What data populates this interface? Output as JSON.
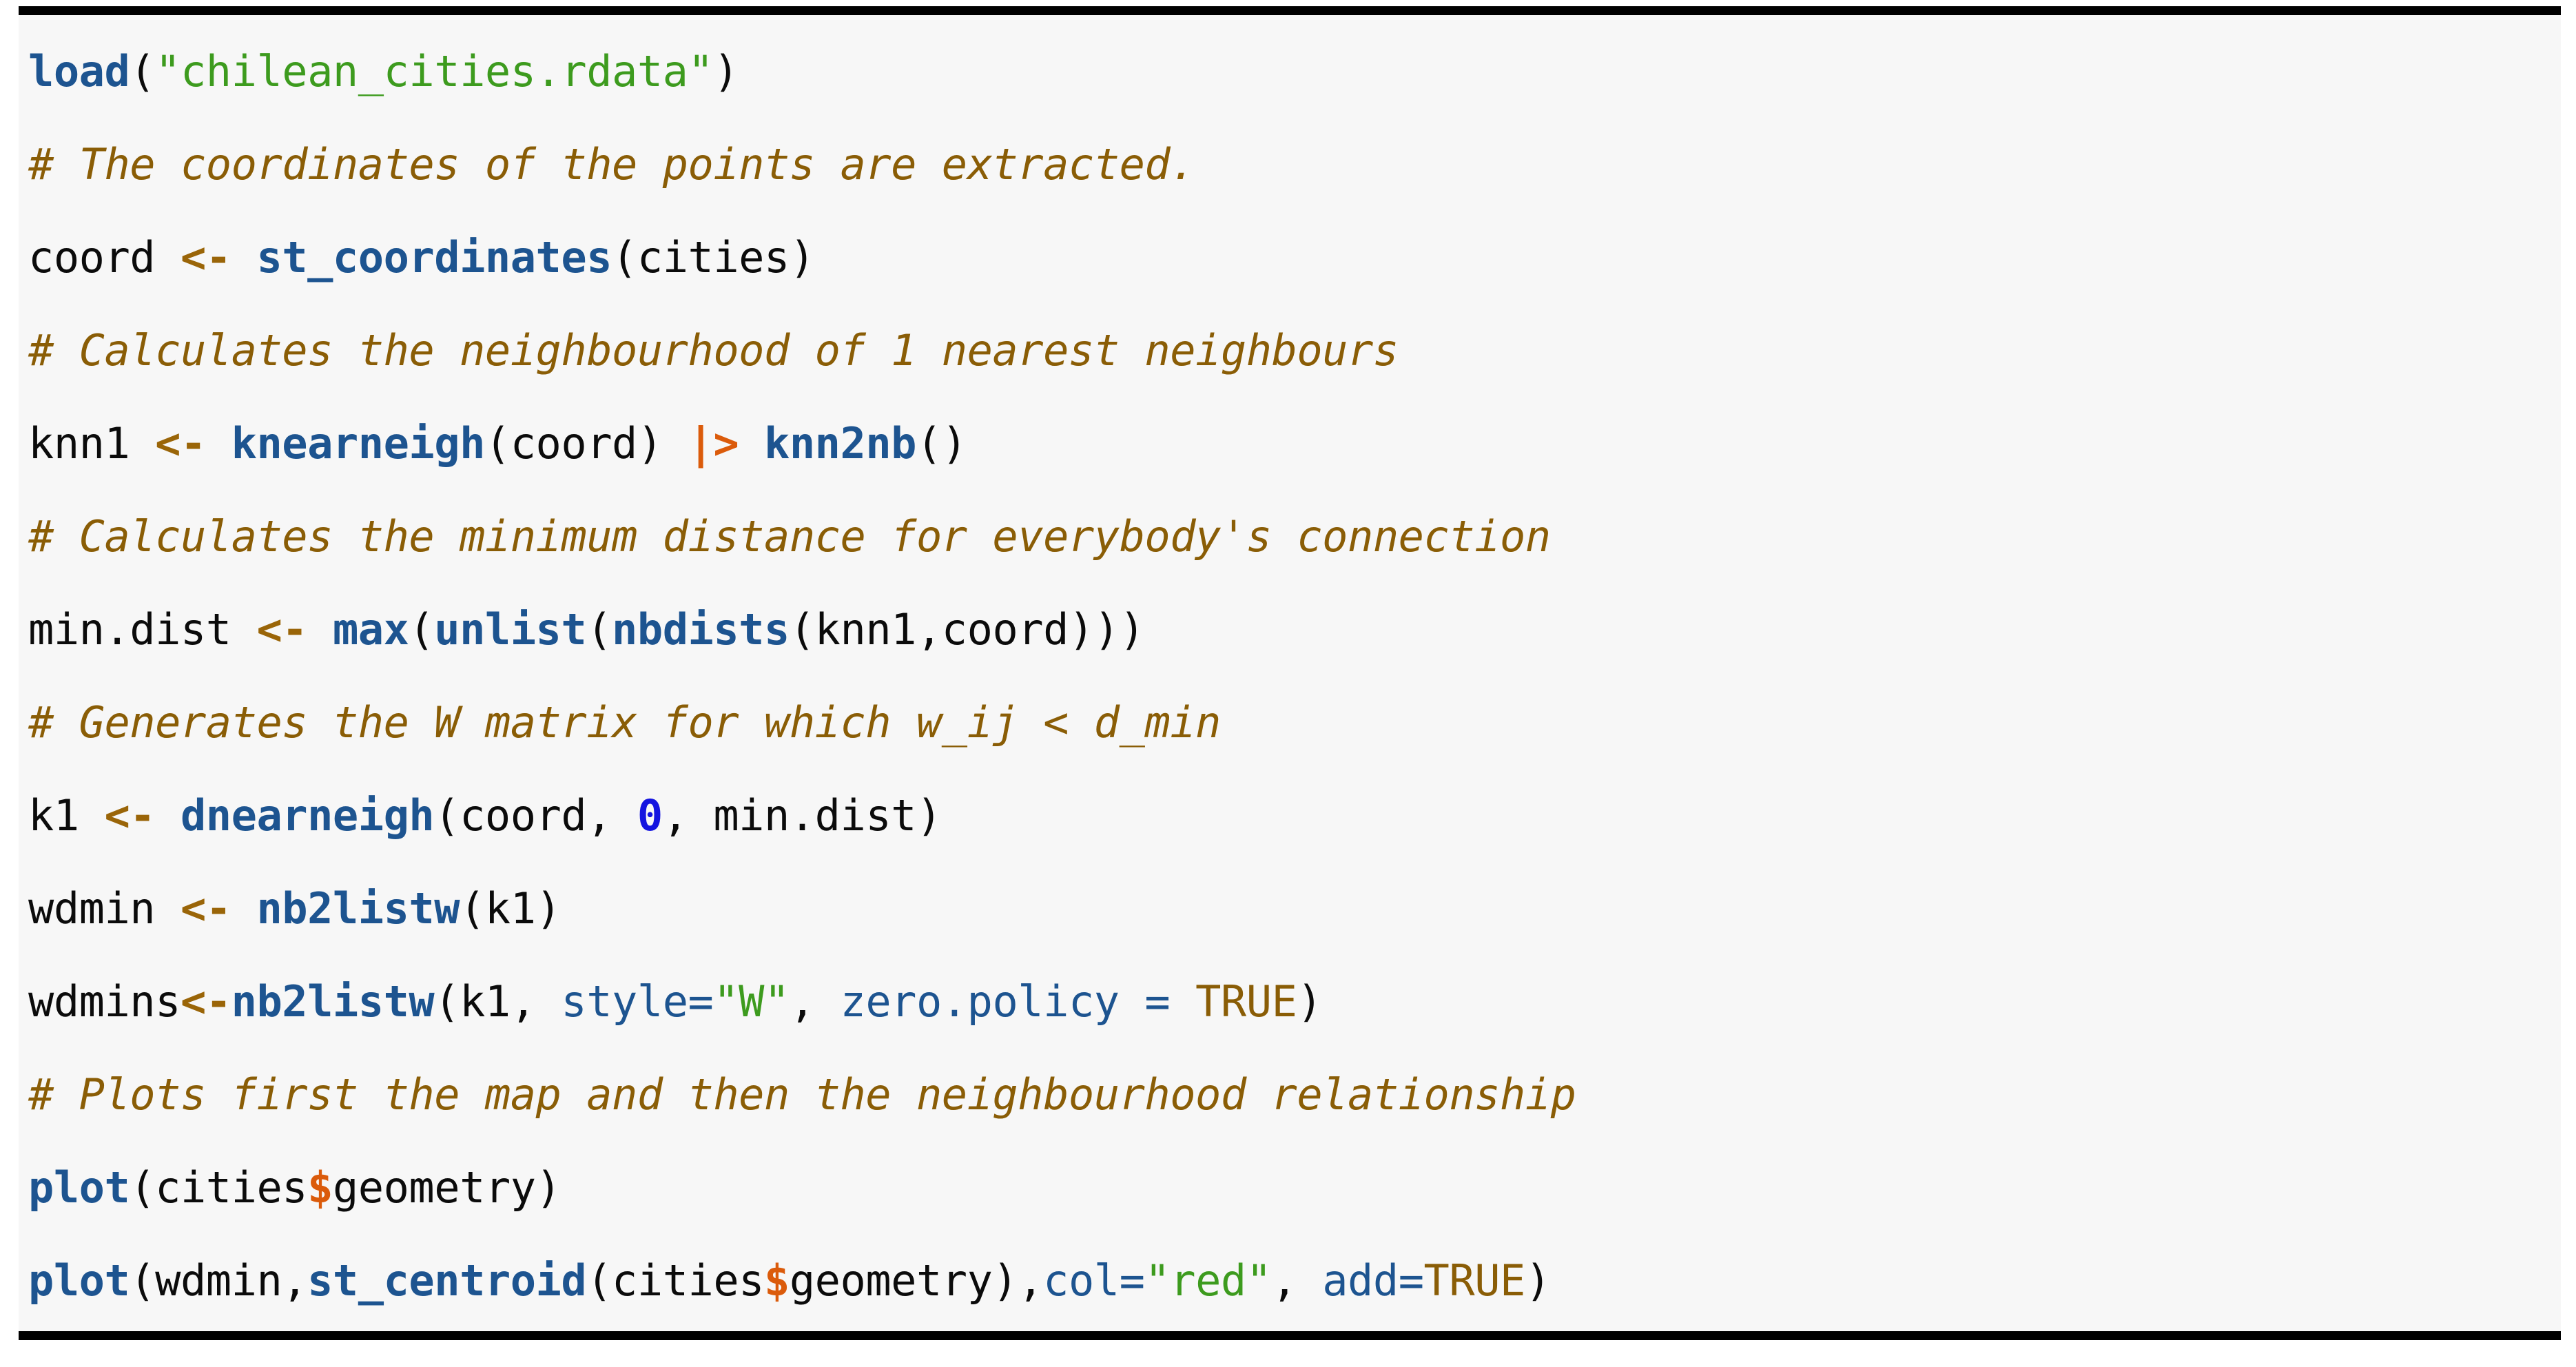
{
  "code_block": {
    "language": "R",
    "background_color": "#f7f7f7",
    "border_color": "#000000",
    "colors": {
      "function": "#1d5490",
      "string": "#3d9b1e",
      "comment": "#8a5d06",
      "assign_operator": "#9a6508",
      "pipe_operator": "#db5b0b",
      "number": "#1414e0",
      "argument": "#1d5490",
      "constant": "#8a5d06",
      "dollar_operator": "#db5b0b",
      "default_text": "#0b0b0b"
    },
    "lines": [
      {
        "index": 1,
        "kind": "code",
        "text": "load(\"chilean_cities.rdata\")",
        "tokens": [
          {
            "t": "load",
            "c": "func"
          },
          {
            "t": "(",
            "c": "punct"
          },
          {
            "t": "\"chilean_cities.rdata\"",
            "c": "string"
          },
          {
            "t": ")",
            "c": "punct"
          }
        ]
      },
      {
        "index": 2,
        "kind": "comment",
        "text": "# The coordinates of the points are extracted.",
        "tokens": [
          {
            "t": "# The coordinates of the points are extracted.",
            "c": "comment"
          }
        ]
      },
      {
        "index": 3,
        "kind": "code",
        "text": "coord <- st_coordinates(cities)",
        "tokens": [
          {
            "t": "coord ",
            "c": "var"
          },
          {
            "t": "<-",
            "c": "assign"
          },
          {
            "t": " ",
            "c": "default"
          },
          {
            "t": "st_coordinates",
            "c": "func"
          },
          {
            "t": "(cities)",
            "c": "punct"
          }
        ]
      },
      {
        "index": 4,
        "kind": "comment",
        "text": "# Calculates the neighbourhood of 1 nearest neighbours",
        "tokens": [
          {
            "t": "# Calculates the neighbourhood of 1 nearest neighbours",
            "c": "comment"
          }
        ]
      },
      {
        "index": 5,
        "kind": "code",
        "text": "knn1 <- knearneigh(coord) |> knn2nb()",
        "tokens": [
          {
            "t": "knn1 ",
            "c": "var"
          },
          {
            "t": "<-",
            "c": "assign"
          },
          {
            "t": " ",
            "c": "default"
          },
          {
            "t": "knearneigh",
            "c": "func"
          },
          {
            "t": "(coord) ",
            "c": "punct"
          },
          {
            "t": "|>",
            "c": "pipe"
          },
          {
            "t": " ",
            "c": "default"
          },
          {
            "t": "knn2nb",
            "c": "func"
          },
          {
            "t": "()",
            "c": "punct"
          }
        ]
      },
      {
        "index": 6,
        "kind": "comment",
        "text": "# Calculates the minimum distance for everybody's connection",
        "tokens": [
          {
            "t": "# Calculates the minimum distance for everybody's connection",
            "c": "comment"
          }
        ]
      },
      {
        "index": 7,
        "kind": "code",
        "text": "min.dist <- max(unlist(nbdists(knn1,coord)))",
        "tokens": [
          {
            "t": "min.dist ",
            "c": "var"
          },
          {
            "t": "<-",
            "c": "assign"
          },
          {
            "t": " ",
            "c": "default"
          },
          {
            "t": "max",
            "c": "func"
          },
          {
            "t": "(",
            "c": "punct"
          },
          {
            "t": "unlist",
            "c": "func"
          },
          {
            "t": "(",
            "c": "punct"
          },
          {
            "t": "nbdists",
            "c": "func"
          },
          {
            "t": "(knn1,coord)))",
            "c": "punct"
          }
        ]
      },
      {
        "index": 8,
        "kind": "comment",
        "text": "# Generates the W matrix for which w_ij < d_min",
        "tokens": [
          {
            "t": "# Generates the W matrix for which w_ij < d_min",
            "c": "comment"
          }
        ]
      },
      {
        "index": 9,
        "kind": "code",
        "text": "k1 <- dnearneigh(coord, 0, min.dist)",
        "tokens": [
          {
            "t": "k1 ",
            "c": "var"
          },
          {
            "t": "<-",
            "c": "assign"
          },
          {
            "t": " ",
            "c": "default"
          },
          {
            "t": "dnearneigh",
            "c": "func"
          },
          {
            "t": "(coord, ",
            "c": "punct"
          },
          {
            "t": "0",
            "c": "number"
          },
          {
            "t": ", min.dist)",
            "c": "punct"
          }
        ]
      },
      {
        "index": 10,
        "kind": "code",
        "text": "wdmin <- nb2listw(k1)",
        "tokens": [
          {
            "t": "wdmin ",
            "c": "var"
          },
          {
            "t": "<-",
            "c": "assign"
          },
          {
            "t": " ",
            "c": "default"
          },
          {
            "t": "nb2listw",
            "c": "func"
          },
          {
            "t": "(k1)",
            "c": "punct"
          }
        ]
      },
      {
        "index": 11,
        "kind": "code",
        "text": "wdmins<-nb2listw(k1, style=\"W\", zero.policy = TRUE)",
        "tokens": [
          {
            "t": "wdmins",
            "c": "var"
          },
          {
            "t": "<-",
            "c": "assign"
          },
          {
            "t": "nb2listw",
            "c": "func"
          },
          {
            "t": "(k1, ",
            "c": "punct"
          },
          {
            "t": "style=",
            "c": "arg"
          },
          {
            "t": "\"W\"",
            "c": "string"
          },
          {
            "t": ", ",
            "c": "punct"
          },
          {
            "t": "zero.policy = ",
            "c": "arg"
          },
          {
            "t": "TRUE",
            "c": "const"
          },
          {
            "t": ")",
            "c": "punct"
          }
        ]
      },
      {
        "index": 12,
        "kind": "comment",
        "text": "# Plots first the map and then the neighbourhood relationship",
        "tokens": [
          {
            "t": "# Plots first the map and then the neighbourhood relationship",
            "c": "comment"
          }
        ]
      },
      {
        "index": 13,
        "kind": "code",
        "text": "plot(cities$geometry)",
        "tokens": [
          {
            "t": "plot",
            "c": "func"
          },
          {
            "t": "(cities",
            "c": "punct"
          },
          {
            "t": "$",
            "c": "dollar"
          },
          {
            "t": "geometry)",
            "c": "punct"
          }
        ]
      },
      {
        "index": 14,
        "kind": "code",
        "text": "plot(wdmin,st_centroid(cities$geometry),col=\"red\", add=TRUE)",
        "tokens": [
          {
            "t": "plot",
            "c": "func"
          },
          {
            "t": "(wdmin,",
            "c": "punct"
          },
          {
            "t": "st_centroid",
            "c": "func"
          },
          {
            "t": "(cities",
            "c": "punct"
          },
          {
            "t": "$",
            "c": "dollar"
          },
          {
            "t": "geometry),",
            "c": "punct"
          },
          {
            "t": "col=",
            "c": "arg"
          },
          {
            "t": "\"red\"",
            "c": "string"
          },
          {
            "t": ", ",
            "c": "punct"
          },
          {
            "t": "add=",
            "c": "arg"
          },
          {
            "t": "TRUE",
            "c": "const"
          },
          {
            "t": ")",
            "c": "punct"
          }
        ]
      }
    ]
  }
}
